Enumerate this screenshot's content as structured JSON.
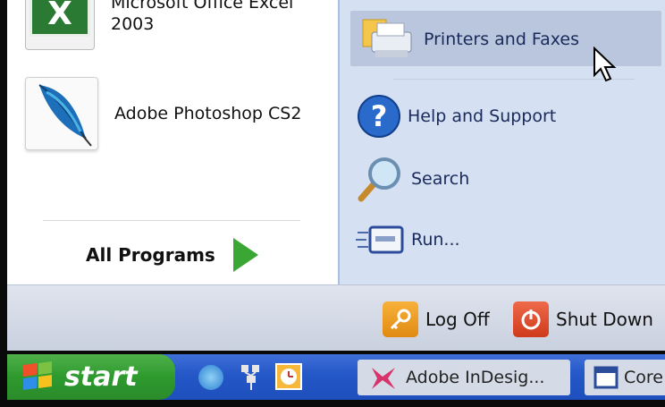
{
  "programs": [
    {
      "label_line1": "Microsoft Office Excel",
      "label_line2": "2003",
      "icon": "excel-icon"
    },
    {
      "label": "Adobe Photoshop CS2",
      "icon": "photoshop-feather-icon"
    }
  ],
  "all_programs": {
    "label": "All Programs",
    "icon": "green-arrow-icon"
  },
  "right_items": [
    {
      "label": "Printers and Faxes",
      "icon": "printer-icon"
    },
    {
      "label": "Help and Support",
      "icon": "help-icon"
    },
    {
      "label": "Search",
      "icon": "search-icon"
    },
    {
      "label": "Run...",
      "icon": "run-icon"
    }
  ],
  "bottom": {
    "log_off": "Log Off",
    "shut_down": "Shut Down"
  },
  "taskbar": {
    "start_label": "start",
    "tasks": [
      {
        "label": "Adobe InDesig...",
        "icon": "indesign-icon"
      },
      {
        "label": "Core",
        "icon": "window-icon"
      }
    ]
  },
  "colors": {
    "right_pane_bg": "#d5e0f3",
    "start_green": "#2e9a2e",
    "taskbar_blue": "#2457c7"
  }
}
